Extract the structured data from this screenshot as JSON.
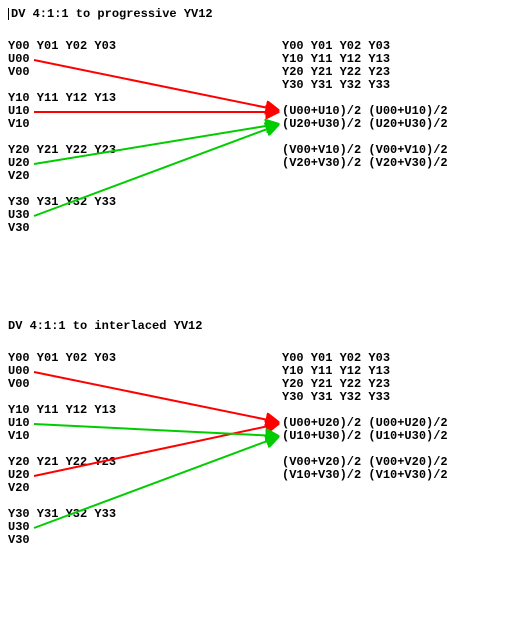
{
  "sections": [
    {
      "title": "DV 4:1:1 to progressive YV12",
      "left": [
        "Y00 Y01 Y02 Y03",
        "U00",
        "V00",
        "",
        "Y10 Y11 Y12 Y13",
        "U10",
        "V10",
        "",
        "Y20 Y21 Y22 Y23",
        "U20",
        "V20",
        "",
        "Y30 Y31 Y32 Y33",
        "U30",
        "V30"
      ],
      "right": [
        "Y00 Y01 Y02 Y03",
        "Y10 Y11 Y12 Y13",
        "Y20 Y21 Y22 Y23",
        "Y30 Y31 Y32 Y33",
        "",
        "(U00+U10)/2 (U00+U10)/2",
        "(U20+U30)/2 (U20+U30)/2",
        "",
        "(V00+V10)/2 (V00+V10)/2",
        "(V20+V30)/2 (V20+V30)/2"
      ]
    },
    {
      "title": "DV 4:1:1 to interlaced YV12",
      "left": [
        "Y00 Y01 Y02 Y03",
        "U00",
        "V00",
        "",
        "Y10 Y11 Y12 Y13",
        "U10",
        "V10",
        "",
        "Y20 Y21 Y22 Y23",
        "U20",
        "V20",
        "",
        "Y30 Y31 Y32 Y33",
        "U30",
        "V30"
      ],
      "right": [
        "Y00 Y01 Y02 Y03",
        "Y10 Y11 Y12 Y13",
        "Y20 Y21 Y22 Y23",
        "Y30 Y31 Y32 Y33",
        "",
        "(U00+U20)/2 (U00+U20)/2",
        "(U10+U30)/2 (U10+U30)/2",
        "",
        "(V00+V20)/2 (V00+V20)/2",
        "(V10+V30)/2 (V10+V30)/2"
      ]
    }
  ],
  "chart_data": [
    {
      "type": "diagram",
      "title": "DV 4:1:1 to progressive YV12",
      "arrows": [
        {
          "from": "U00",
          "to": "(U00+U10)/2",
          "color": "red"
        },
        {
          "from": "U10",
          "to": "(U00+U10)/2",
          "color": "red"
        },
        {
          "from": "U20",
          "to": "(U20+U30)/2",
          "color": "green"
        },
        {
          "from": "U30",
          "to": "(U20+U30)/2",
          "color": "green"
        }
      ]
    },
    {
      "type": "diagram",
      "title": "DV 4:1:1 to interlaced YV12",
      "arrows": [
        {
          "from": "U00",
          "to": "(U00+U20)/2",
          "color": "red"
        },
        {
          "from": "U20",
          "to": "(U00+U20)/2",
          "color": "red"
        },
        {
          "from": "U10",
          "to": "(U10+U30)/2",
          "color": "green"
        },
        {
          "from": "U30",
          "to": "(U10+U30)/2",
          "color": "green"
        }
      ]
    }
  ]
}
